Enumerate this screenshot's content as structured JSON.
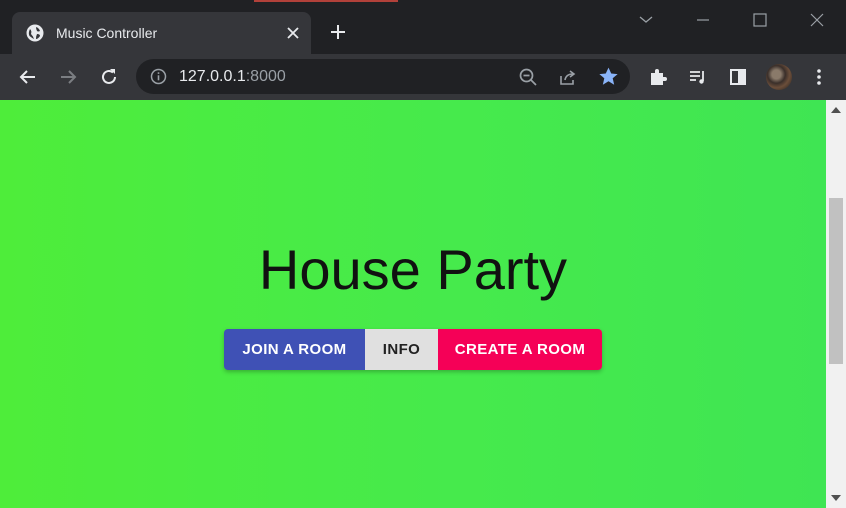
{
  "browser": {
    "tab_title": "Music Controller",
    "url_host": "127.0.0.1",
    "url_port": ":8000"
  },
  "page": {
    "heading": "House Party",
    "buttons": {
      "join": "JOIN A ROOM",
      "info": "INFO",
      "create": "CREATE A ROOM"
    }
  },
  "colors": {
    "join_button": "#3f51b5",
    "info_button": "#e0e0e0",
    "create_button": "#f50057",
    "background_start": "#4eed3a",
    "background_end": "#3fe553"
  }
}
